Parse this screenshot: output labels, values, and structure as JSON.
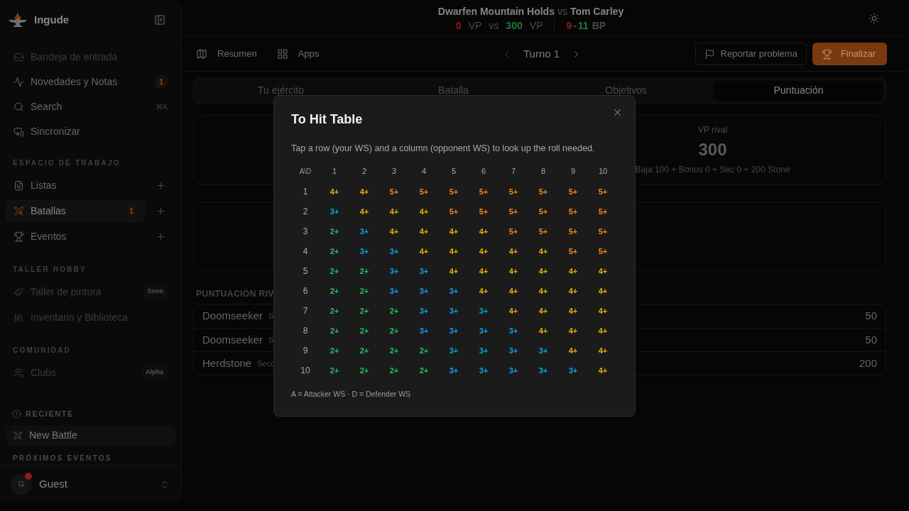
{
  "sidebar": {
    "brand": "Ingude",
    "top_items": [
      {
        "label": "Bandeja de entrada",
        "selected": false,
        "disabled": true
      },
      {
        "label": "Novedades y Notas",
        "selected": false,
        "disabled": false,
        "badge": {
          "text": "1",
          "kind": "count"
        }
      },
      {
        "label": "Search",
        "selected": false,
        "disabled": false,
        "shortcut": "⌘K"
      },
      {
        "label": "Sincronizar",
        "selected": false,
        "disabled": false
      }
    ],
    "sections": [
      {
        "heading": "ESPACIO DE TRABAJO",
        "addable": true,
        "items": [
          {
            "label": "Listas",
            "selected": false,
            "disabled": false
          },
          {
            "label": "Batallas",
            "selected": true,
            "disabled": false,
            "badge": {
              "text": "1",
              "kind": "count"
            }
          },
          {
            "label": "Eventos",
            "selected": false,
            "disabled": false
          }
        ]
      },
      {
        "heading": "TALLER HOBBY",
        "addable": false,
        "items": [
          {
            "label": "Taller de pintura",
            "selected": false,
            "disabled": true,
            "badge": {
              "text": "Soon",
              "kind": "tag"
            }
          },
          {
            "label": "Inventario y Biblioteca",
            "selected": false,
            "disabled": true
          }
        ]
      },
      {
        "heading": "COMUNIDAD",
        "addable": false,
        "items": [
          {
            "label": "Clubs",
            "selected": false,
            "disabled": true,
            "badge": {
              "text": "Alpha",
              "kind": "tag"
            }
          }
        ]
      }
    ],
    "recent": {
      "heading": "RECIENTE",
      "items": [
        {
          "label": "New Battle"
        }
      ]
    },
    "upcoming_heading": "PRÓXIMOS EVENTOS",
    "user": {
      "initial": "G",
      "name": "Guest",
      "notification": true
    }
  },
  "header": {
    "team": "Dwarfen Mountain Holds",
    "versus": "vs",
    "opponent": "Tom Carley",
    "score": {
      "own": "0",
      "own_unit": "VP",
      "separator": "vs",
      "rival": "300",
      "rival_unit": "VP"
    },
    "battle_points": {
      "own": "9",
      "dash": "-",
      "rival": "11",
      "unit": "BP"
    }
  },
  "toolbar": {
    "left": [
      {
        "label": "Resumen"
      },
      {
        "label": "Apps"
      }
    ],
    "turn": "Turno 1",
    "actions": [
      {
        "label": "Reportar problema",
        "kind": "outline"
      },
      {
        "label": "Finalizar",
        "kind": "primary"
      }
    ]
  },
  "tabs": [
    {
      "label": "Tu ejército",
      "selected": false
    },
    {
      "label": "Batalla",
      "selected": false
    },
    {
      "label": "Objetivos",
      "selected": false
    },
    {
      "label": "Puntuación",
      "selected": true
    }
  ],
  "score_card": {
    "label": "VP rival",
    "value": "300",
    "breakdown": "Baja 100 + Bonus 0 + Sec 0 + 200 Stone"
  },
  "rival_scoring": {
    "heading": "PUNTUACIÓN RIV",
    "rows": [
      {
        "name": "Doomseeker",
        "detail": "S",
        "points": "50"
      },
      {
        "name": "Doomseeker",
        "detail": "S",
        "points": "50"
      },
      {
        "name": "Herdstone",
        "detail": "Seco",
        "points": "200"
      }
    ]
  },
  "to_hit_table": {
    "title": "To Hit Table",
    "description": "Tap a row (your WS) and a column (opponent WS) to look up the roll needed.",
    "corner": "A\\D",
    "columns": [
      "1",
      "2",
      "3",
      "4",
      "5",
      "6",
      "7",
      "8",
      "9",
      "10"
    ],
    "rows": [
      {
        "label": "1",
        "cells": [
          {
            "value": "4+",
            "color": "#eab308"
          },
          {
            "value": "4+",
            "color": "#eab308"
          },
          {
            "value": "5+",
            "color": "#f48a1c"
          },
          {
            "value": "5+",
            "color": "#f48a1c"
          },
          {
            "value": "5+",
            "color": "#f48a1c"
          },
          {
            "value": "5+",
            "color": "#f48a1c"
          },
          {
            "value": "5+",
            "color": "#f48a1c"
          },
          {
            "value": "5+",
            "color": "#f48a1c"
          },
          {
            "value": "5+",
            "color": "#f48a1c"
          },
          {
            "value": "5+",
            "color": "#f48a1c"
          }
        ]
      },
      {
        "label": "2",
        "cells": [
          {
            "value": "3+",
            "color": "#0ea5e9"
          },
          {
            "value": "4+",
            "color": "#eab308"
          },
          {
            "value": "4+",
            "color": "#eab308"
          },
          {
            "value": "4+",
            "color": "#eab308"
          },
          {
            "value": "5+",
            "color": "#f48a1c"
          },
          {
            "value": "5+",
            "color": "#f48a1c"
          },
          {
            "value": "5+",
            "color": "#f48a1c"
          },
          {
            "value": "5+",
            "color": "#f48a1c"
          },
          {
            "value": "5+",
            "color": "#f48a1c"
          },
          {
            "value": "5+",
            "color": "#f48a1c"
          }
        ]
      },
      {
        "label": "3",
        "cells": [
          {
            "value": "2+",
            "color": "#22c55e"
          },
          {
            "value": "3+",
            "color": "#0ea5e9"
          },
          {
            "value": "4+",
            "color": "#eab308"
          },
          {
            "value": "4+",
            "color": "#eab308"
          },
          {
            "value": "4+",
            "color": "#eab308"
          },
          {
            "value": "4+",
            "color": "#eab308"
          },
          {
            "value": "5+",
            "color": "#f48a1c"
          },
          {
            "value": "5+",
            "color": "#f48a1c"
          },
          {
            "value": "5+",
            "color": "#f48a1c"
          },
          {
            "value": "5+",
            "color": "#f48a1c"
          }
        ]
      },
      {
        "label": "4",
        "cells": [
          {
            "value": "2+",
            "color": "#22c55e"
          },
          {
            "value": "3+",
            "color": "#0ea5e9"
          },
          {
            "value": "3+",
            "color": "#0ea5e9"
          },
          {
            "value": "4+",
            "color": "#eab308"
          },
          {
            "value": "4+",
            "color": "#eab308"
          },
          {
            "value": "4+",
            "color": "#eab308"
          },
          {
            "value": "4+",
            "color": "#eab308"
          },
          {
            "value": "4+",
            "color": "#eab308"
          },
          {
            "value": "5+",
            "color": "#f48a1c"
          },
          {
            "value": "5+",
            "color": "#f48a1c"
          }
        ]
      },
      {
        "label": "5",
        "cells": [
          {
            "value": "2+",
            "color": "#22c55e"
          },
          {
            "value": "2+",
            "color": "#22c55e"
          },
          {
            "value": "3+",
            "color": "#0ea5e9"
          },
          {
            "value": "3+",
            "color": "#0ea5e9"
          },
          {
            "value": "4+",
            "color": "#eab308"
          },
          {
            "value": "4+",
            "color": "#eab308"
          },
          {
            "value": "4+",
            "color": "#eab308"
          },
          {
            "value": "4+",
            "color": "#eab308"
          },
          {
            "value": "4+",
            "color": "#eab308"
          },
          {
            "value": "4+",
            "color": "#eab308"
          }
        ]
      },
      {
        "label": "6",
        "cells": [
          {
            "value": "2+",
            "color": "#22c55e"
          },
          {
            "value": "2+",
            "color": "#22c55e"
          },
          {
            "value": "3+",
            "color": "#0ea5e9"
          },
          {
            "value": "3+",
            "color": "#0ea5e9"
          },
          {
            "value": "3+",
            "color": "#0ea5e9"
          },
          {
            "value": "4+",
            "color": "#eab308"
          },
          {
            "value": "4+",
            "color": "#eab308"
          },
          {
            "value": "4+",
            "color": "#eab308"
          },
          {
            "value": "4+",
            "color": "#eab308"
          },
          {
            "value": "4+",
            "color": "#eab308"
          }
        ]
      },
      {
        "label": "7",
        "cells": [
          {
            "value": "2+",
            "color": "#22c55e"
          },
          {
            "value": "2+",
            "color": "#22c55e"
          },
          {
            "value": "2+",
            "color": "#22c55e"
          },
          {
            "value": "3+",
            "color": "#0ea5e9"
          },
          {
            "value": "3+",
            "color": "#0ea5e9"
          },
          {
            "value": "3+",
            "color": "#0ea5e9"
          },
          {
            "value": "4+",
            "color": "#eab308"
          },
          {
            "value": "4+",
            "color": "#eab308"
          },
          {
            "value": "4+",
            "color": "#eab308"
          },
          {
            "value": "4+",
            "color": "#eab308"
          }
        ]
      },
      {
        "label": "8",
        "cells": [
          {
            "value": "2+",
            "color": "#22c55e"
          },
          {
            "value": "2+",
            "color": "#22c55e"
          },
          {
            "value": "2+",
            "color": "#22c55e"
          },
          {
            "value": "3+",
            "color": "#0ea5e9"
          },
          {
            "value": "3+",
            "color": "#0ea5e9"
          },
          {
            "value": "3+",
            "color": "#0ea5e9"
          },
          {
            "value": "3+",
            "color": "#0ea5e9"
          },
          {
            "value": "4+",
            "color": "#eab308"
          },
          {
            "value": "4+",
            "color": "#eab308"
          },
          {
            "value": "4+",
            "color": "#eab308"
          }
        ]
      },
      {
        "label": "9",
        "cells": [
          {
            "value": "2+",
            "color": "#22c55e"
          },
          {
            "value": "2+",
            "color": "#22c55e"
          },
          {
            "value": "2+",
            "color": "#22c55e"
          },
          {
            "value": "2+",
            "color": "#22c55e"
          },
          {
            "value": "3+",
            "color": "#0ea5e9"
          },
          {
            "value": "3+",
            "color": "#0ea5e9"
          },
          {
            "value": "3+",
            "color": "#0ea5e9"
          },
          {
            "value": "3+",
            "color": "#0ea5e9"
          },
          {
            "value": "4+",
            "color": "#eab308"
          },
          {
            "value": "4+",
            "color": "#eab308"
          }
        ]
      },
      {
        "label": "10",
        "cells": [
          {
            "value": "2+",
            "color": "#22c55e"
          },
          {
            "value": "2+",
            "color": "#22c55e"
          },
          {
            "value": "2+",
            "color": "#22c55e"
          },
          {
            "value": "2+",
            "color": "#22c55e"
          },
          {
            "value": "3+",
            "color": "#0ea5e9"
          },
          {
            "value": "3+",
            "color": "#0ea5e9"
          },
          {
            "value": "3+",
            "color": "#0ea5e9"
          },
          {
            "value": "3+",
            "color": "#0ea5e9"
          },
          {
            "value": "3+",
            "color": "#0ea5e9"
          },
          {
            "value": "4+",
            "color": "#eab308"
          }
        ]
      }
    ],
    "legend": "A = Attacker WS · D = Defender WS"
  }
}
